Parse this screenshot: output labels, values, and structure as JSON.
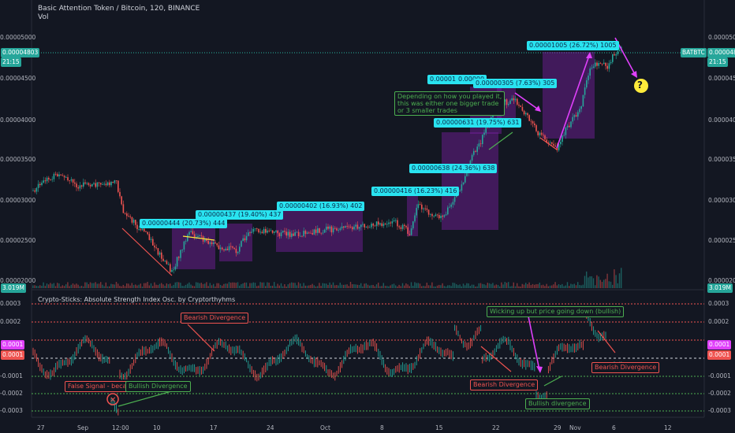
{
  "header": {
    "title": "Basic Attention Token / Bitcoin, 120, BINANCE",
    "vol_label": "Vol"
  },
  "price_axis": {
    "labels": [
      "0.00005000",
      "0.00004500",
      "0.00004000",
      "0.00003500",
      "0.00003000",
      "0.00002500",
      "0.00002000"
    ]
  },
  "price_tags": {
    "last_price": "0.00004803",
    "countdown": "21:15",
    "symbol": "BATBTC",
    "volume": "3.019M",
    "volume_right": "3.019M"
  },
  "indicator": {
    "title": "Crypto-Sticks: Absolute Strength Index Osc. by Cryptorthyhms",
    "axis_labels": [
      "0.0003",
      "0.0002",
      "0.0001",
      "-0.0001",
      "-0.0002",
      "-0.0003"
    ],
    "left_tags": [
      "0.0001",
      "0.0001"
    ],
    "right_tags": [
      "0.0001",
      "0.0001"
    ]
  },
  "time_axis": {
    "labels": [
      "27",
      "Sep",
      "12:00",
      "10",
      "17",
      "24",
      "Oct",
      "8",
      "15",
      "22",
      "29",
      "Nov",
      "6",
      "12"
    ]
  },
  "trade_boxes": [
    {
      "text": "0.00000444 (20.73%) 444"
    },
    {
      "text": "0.00000437 (19.40%) 437"
    },
    {
      "text": "0.00000402 (16.93%) 402"
    },
    {
      "text": "0.00000416 (16.23%) 416"
    },
    {
      "text": "0.00000638 (24.36%) 638"
    },
    {
      "text": "0.00000631 (19.75%) 631"
    },
    {
      "text": "0.00000305 (7.63%) 305"
    },
    {
      "text": "0.00001"
    },
    {
      "text": "0.00000"
    },
    {
      "text": "0.00001005 (26.72%) 1005"
    }
  ],
  "annotations": {
    "trade_note": [
      "Depending on how you played it,",
      "this was either one bigger trade",
      "or 3 smaller trades"
    ],
    "question_mark": "?",
    "bearish_div_1": "Bearish Divergence",
    "bearish_div_2": "Bearish Divergence",
    "bearish_div_3": "Bearish Divergence",
    "bullish_div_1": "Bullish Divergence",
    "bullish_div_2": "Bullish divergence",
    "false_signal": "False Signal - because of",
    "wicking_note": "Wicking up but price going down (bullish)"
  },
  "colors": {
    "background": "#131722",
    "cyan": "#29e3f0",
    "green": "#4caf50",
    "red": "#ef5350",
    "pink": "#e040fb",
    "purple_zone": "#7b1fa2",
    "yellow": "#ffeb3b"
  }
}
